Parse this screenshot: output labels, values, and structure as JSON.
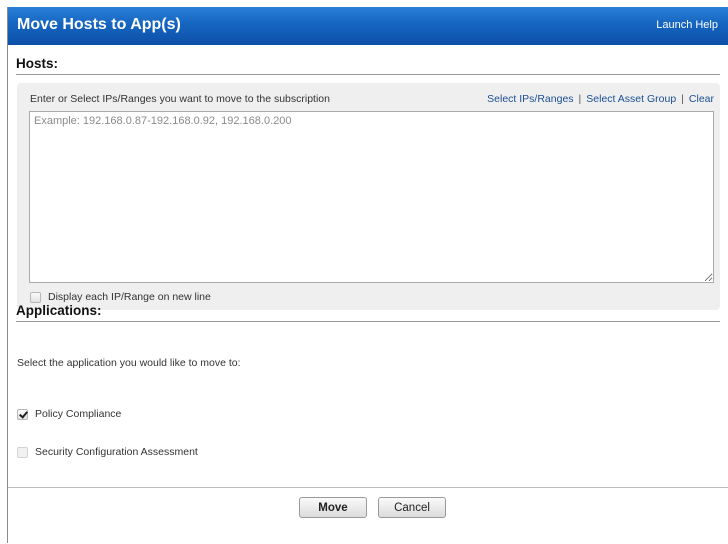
{
  "dialog": {
    "title": "Move Hosts to App(s)",
    "help_label": "Launch Help"
  },
  "hosts": {
    "heading": "Hosts:",
    "prompt": "Enter or Select IPs/Ranges you want to move to the subscription",
    "links": {
      "select_ips": "Select IPs/Ranges",
      "select_group": "Select Asset Group",
      "clear": "Clear",
      "separator": "|"
    },
    "textarea": {
      "value": "",
      "placeholder": "Example: 192.168.0.87-192.168.0.92, 192.168.0.200"
    },
    "newline_option": {
      "label": "Display each IP/Range on new line",
      "checked": false
    }
  },
  "applications": {
    "heading": "Applications:",
    "prompt": "Select the application you would like to move to:",
    "options": [
      {
        "label": "Policy Compliance",
        "checked": true,
        "disabled": false
      },
      {
        "label": "Security Configuration Assessment",
        "checked": false,
        "disabled": true
      }
    ]
  },
  "footer": {
    "move_label": "Move",
    "cancel_label": "Cancel"
  },
  "colors": {
    "titlebar": "#1565c0",
    "link": "#1a4f95",
    "panel_bg": "#efefef"
  }
}
